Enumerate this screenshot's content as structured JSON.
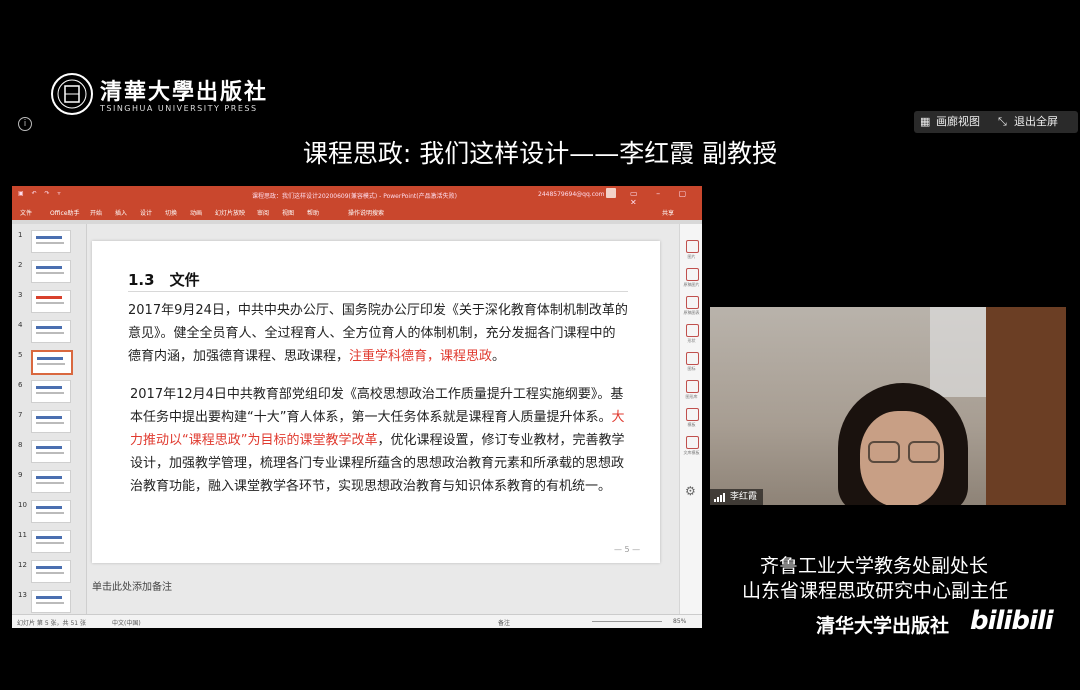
{
  "logo": {
    "cn": "清華大學出版社",
    "en": "TSINGHUA UNIVERSITY PRESS"
  },
  "toolbar": {
    "gallery_label": "画廊视图",
    "exit_fullscreen_label": "退出全屏"
  },
  "meeting_title": "课程思政: 我们这样设计——李红霞 副教授",
  "ppt": {
    "window_title": "课程思政：我们这样设计20200609(兼容模式) - PowerPoint(产品激活失败)",
    "account": "2448579694@qq.com",
    "menu": [
      "文件",
      "Office助手",
      "开始",
      "插入",
      "设计",
      "切换",
      "动画",
      "幻灯片放映",
      "审阅",
      "视图",
      "帮助",
      "操作说明搜索"
    ],
    "share": "共享",
    "thumb_numbers": [
      "1",
      "2",
      "3",
      "4",
      "5",
      "6",
      "7",
      "8",
      "9",
      "10",
      "11",
      "12",
      "13"
    ],
    "selected_slide": 5,
    "slide": {
      "header": "1.3　文件",
      "para1_a": "2017年9月24日，中共中央办公厅、国务院办公厅印发《关于深化教育体制机制改革的意见》。健全全员育人、全过程育人、全方位育人的体制机制，充分发掘各门课程中的德育内涵，加强德育课程、思政课程，",
      "para1_red": "注重学科德育，课程思政",
      "para1_end": "。",
      "para2_a": "2017年12月4日中共教育部党组印发《高校思想政治工作质量提升工程实施纲要》。基本任务中提出要构建“十大”育人体系，第一大任务体系就是课程育人质量提升体系。",
      "para2_red": "大力推动以“课程思政”为目标的课堂教学改革",
      "para2_b": "，优化课程设置，修订专业教材，完善教学设计，加强教学管理，梳理各门专业课程所蕴含的思想政治教育元素和所承载的思想政治教育功能，融入课堂教学各环节，实现思想政治教育与知识体系教育的有机统一。",
      "page_number": "— 5 —"
    },
    "notes_placeholder": "单击此处添加备注",
    "status_left": "幻灯片 第 5 张，共 51 张",
    "status_lang": "中文(中国)",
    "status_notes": "备注",
    "zoom": "85%",
    "right_panel": [
      "图片",
      "原稿图片",
      "原稿图表",
      "形状",
      "图标",
      "图形库",
      "模板",
      "文库模板"
    ]
  },
  "webcam": {
    "name": "李红霞"
  },
  "captions": {
    "line1": "齐鲁工业大学教务处副处长",
    "line2": "山东省课程思政研究中心副主任",
    "publisher": "清华大学出版社",
    "watermark": "bilibili"
  },
  "colors": {
    "ppt_accent": "#c9472d",
    "highlight_red": "#e03a2f",
    "background": "#000000"
  }
}
